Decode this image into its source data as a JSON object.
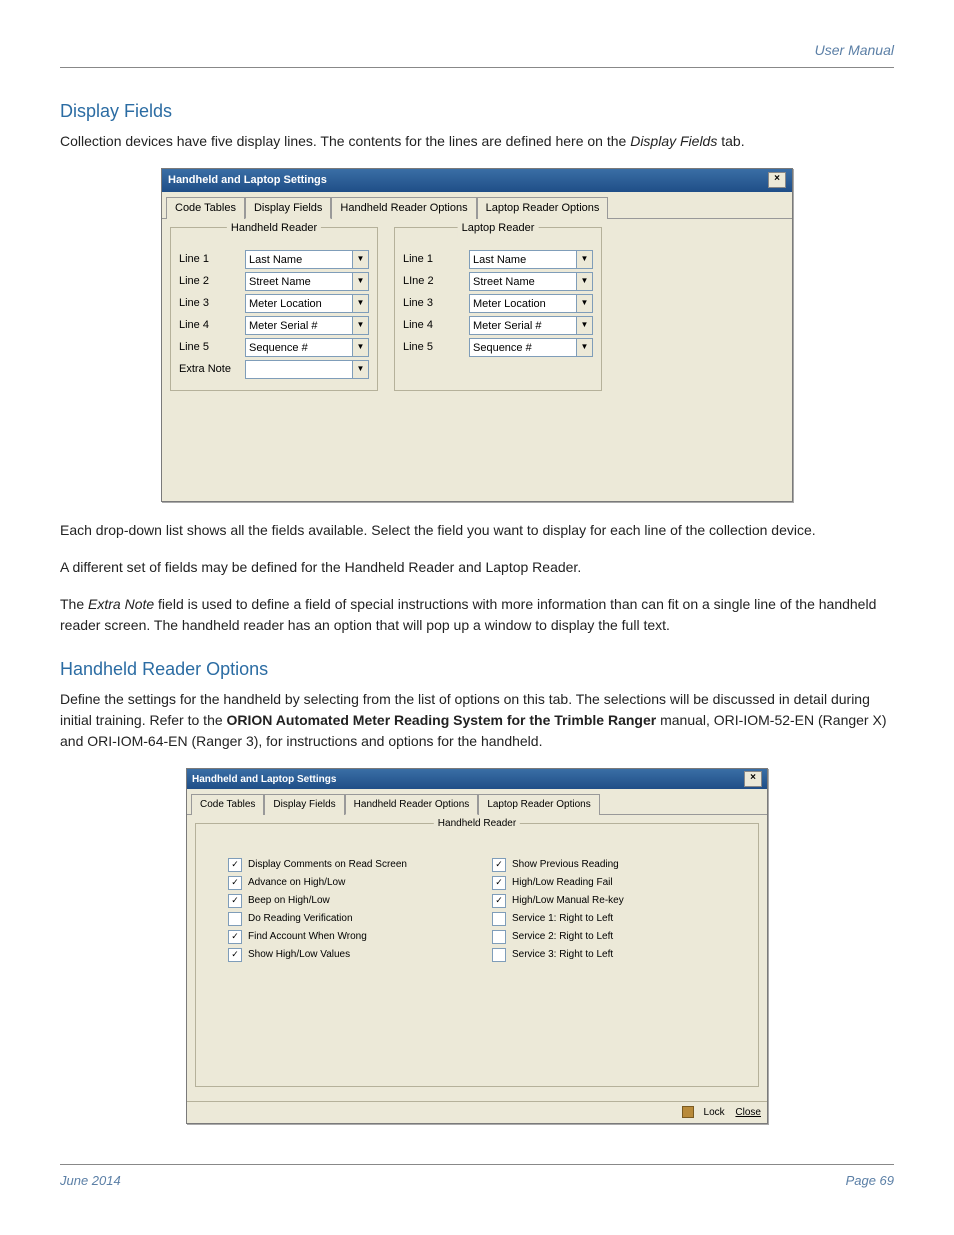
{
  "header": {
    "right": "User Manual"
  },
  "section1": {
    "title": "Display Fields",
    "intro_pre": "Collection devices have five display lines. The contents for the lines are defined here on the ",
    "intro_italic": "Display Fields",
    "intro_post": " tab.",
    "p2": "Each drop-down list shows all the fields available. Select the field you want to display for each line of the collection device.",
    "p3": "A different set of fields may be defined for the Handheld Reader and Laptop Reader.",
    "p4_pre": "The ",
    "p4_italic": "Extra Note",
    "p4_post": " field is used to define a field of special instructions with more information than can fit on a single line of the handheld reader screen. The handheld reader has an option that will pop up a window to display the full text."
  },
  "dialog1": {
    "title": "Handheld and Laptop Settings",
    "tabs": [
      "Code Tables",
      "Display Fields",
      "Handheld Reader Options",
      "Laptop Reader Options"
    ],
    "active_tab": 1,
    "left_legend": "Handheld Reader",
    "right_legend": "Laptop Reader",
    "left_rows": [
      {
        "label": "Line 1",
        "value": "Last Name"
      },
      {
        "label": "Line 2",
        "value": "Street Name"
      },
      {
        "label": "Line 3",
        "value": "Meter Location"
      },
      {
        "label": "Line 4",
        "value": "Meter Serial #"
      },
      {
        "label": "Line 5",
        "value": "Sequence #"
      },
      {
        "label": "Extra Note",
        "value": ""
      }
    ],
    "right_rows": [
      {
        "label": "Line 1",
        "value": "Last Name"
      },
      {
        "label": "LIne 2",
        "value": "Street Name"
      },
      {
        "label": "Line 3",
        "value": "Meter Location"
      },
      {
        "label": "Line 4",
        "value": "Meter Serial #"
      },
      {
        "label": "Line 5",
        "value": "Sequence #"
      }
    ]
  },
  "section2": {
    "title": "Handheld Reader Options",
    "p1_pre": "Define the settings for the handheld by selecting from the list of options on this tab. The selections will be discussed in detail during initial training. Refer to the ",
    "p1_bold": "ORION Automated Meter Reading System for the Trimble Ranger",
    "p1_post": " manual, ORI-IOM-52-EN (Ranger X) and ORI-IOM-64-EN (Ranger 3), for instructions and options for the handheld."
  },
  "dialog2": {
    "title": "Handheld and Laptop Settings",
    "tabs": [
      "Code Tables",
      "Display Fields",
      "Handheld Reader Options",
      "Laptop Reader Options"
    ],
    "active_tab": 2,
    "group_legend": "Handheld Reader",
    "left_checks": [
      {
        "label": "Display Comments on Read Screen",
        "checked": true
      },
      {
        "label": "Advance on High/Low",
        "checked": true
      },
      {
        "label": "Beep on High/Low",
        "checked": true
      },
      {
        "label": "Do Reading Verification",
        "checked": false
      },
      {
        "label": "Find Account When Wrong",
        "checked": true
      },
      {
        "label": "Show High/Low Values",
        "checked": true
      }
    ],
    "right_checks": [
      {
        "label": "Show Previous Reading",
        "checked": true
      },
      {
        "label": "High/Low Reading Fail",
        "checked": true
      },
      {
        "label": "High/Low Manual Re-key",
        "checked": true
      },
      {
        "label": "Service 1: Right to Left",
        "checked": false
      },
      {
        "label": "Service 2: Right to Left",
        "checked": false
      },
      {
        "label": "Service 3: Right to Left",
        "checked": false
      }
    ],
    "footer": {
      "lock": "Lock",
      "close": "Close"
    }
  },
  "footer": {
    "left": "June 2014",
    "right": "Page 69"
  }
}
